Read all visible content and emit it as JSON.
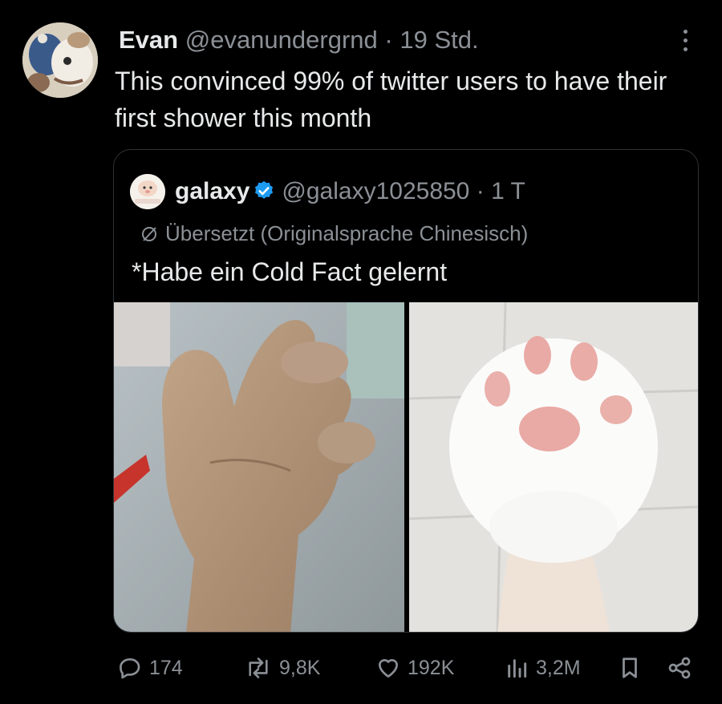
{
  "tweet": {
    "author_name": "Evan",
    "author_handle": "@evanundergrnd",
    "separator": "·",
    "time": "19 Std.",
    "text": "This convinced 99% of twitter users to have their first shower this month"
  },
  "quoted_tweet": {
    "author_name": "galaxy",
    "author_handle": "@galaxy1025850",
    "separator": "·",
    "time": "1 T",
    "translation_note": "Übersetzt (Originalsprache Chinesisch)",
    "text": "*Habe ein Cold Fact gelernt",
    "images": [
      "hand-fist-photo",
      "foam-cat-paw-photo"
    ]
  },
  "actions": {
    "replies": "174",
    "reposts": "9,8K",
    "likes": "192K",
    "views": "3,2M"
  },
  "colors": {
    "background": "#000000",
    "text": "#e7e9ea",
    "muted": "#8b9096",
    "border": "#2f3336",
    "verified": "#1d9bf0"
  }
}
